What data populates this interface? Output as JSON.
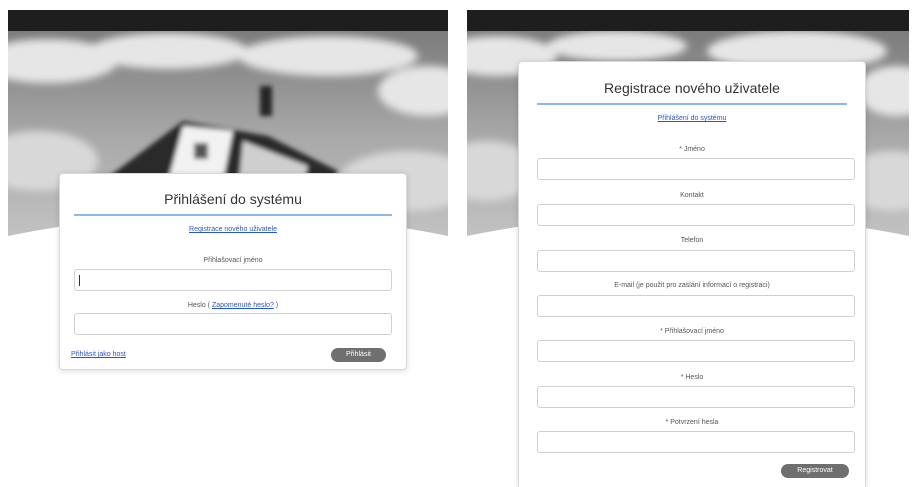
{
  "login": {
    "title": "Přihlášení do systému",
    "register_link": "Registrace nového uživatele",
    "username_label": "Přihlašovací jméno",
    "password_label_prefix": "Heslo ( ",
    "forgot_link": "Zapomenuté heslo?",
    "password_label_suffix": " )",
    "guest_link": "Přihlásit jako host",
    "submit_label": "Přihlásit"
  },
  "registration": {
    "title": "Registrace nového uživatele",
    "login_link": "Přihlášení do systému",
    "fields": {
      "name": "* Jméno",
      "contact": "Kontakt",
      "phone": "Telefon",
      "email": "E-mail (je použit pro zaslání informací o registraci)",
      "username": "* Přihlašovací jméno",
      "password": "* Heslo",
      "password_confirm": "* Potvrzení hesla"
    },
    "submit_label": "Registrovat"
  },
  "colors": {
    "topbar": "#1e1e1e",
    "title_rule": "#8db9e8",
    "link": "#2a57c4",
    "button": "#6f6f6f"
  }
}
